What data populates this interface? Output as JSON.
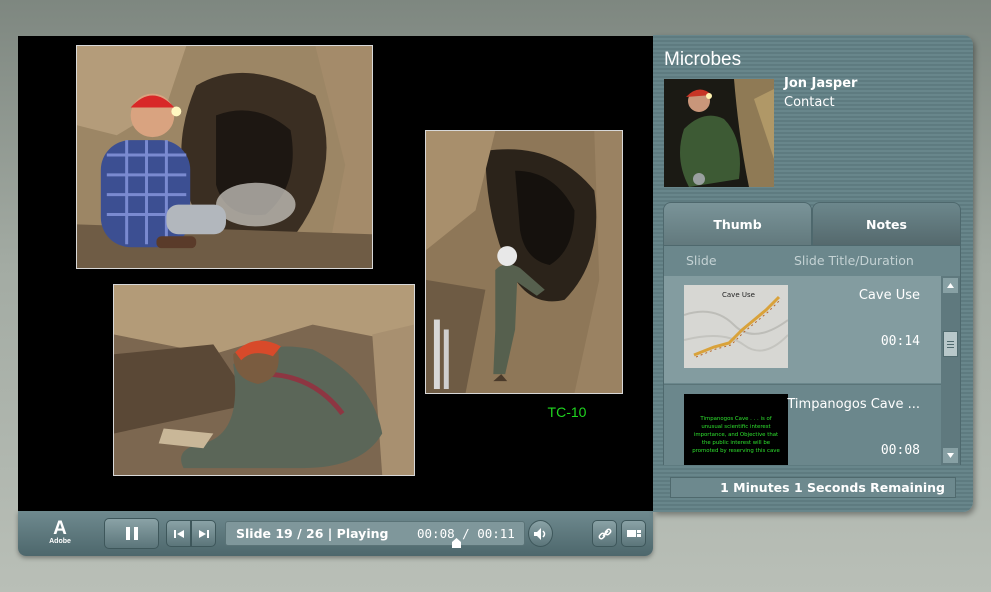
{
  "slide": {
    "caption": "TC-10"
  },
  "controls": {
    "logo_mark": "A",
    "logo_text": "Adobe",
    "slide_status": "Slide 19 / 26 | Playing",
    "time_readout": "00:08 / 00:11",
    "icons": [
      "pause-icon",
      "previous-icon",
      "next-icon",
      "volume-icon",
      "link-icon",
      "layout-icon"
    ]
  },
  "sidebar": {
    "title": "Microbes",
    "presenter_name": "Jon Jasper",
    "contact_label": "Contact",
    "tabs": [
      {
        "label": "Thumb",
        "selected": true
      },
      {
        "label": "Notes",
        "selected": false
      }
    ],
    "columns": {
      "slide": "Slide",
      "title": "Slide Title/Duration"
    },
    "slides": [
      {
        "title": "Cave Use",
        "duration": "00:14",
        "thumb_text": "Cave Use",
        "selected": true
      },
      {
        "title": "Timpanogos Cave ...",
        "duration": "00:08",
        "thumb_text": [
          "Timpanogos Cave . . . is of",
          "unusual scientific interest",
          "importance, and Objective that",
          "the public interest will be",
          "promoted by reserving this cave"
        ],
        "selected": false
      }
    ],
    "remaining": "1 Minutes 1 Seconds Remaining"
  },
  "colors": {
    "caption": "#1fd61f",
    "panel": "#68868b",
    "stage": "#000000"
  }
}
